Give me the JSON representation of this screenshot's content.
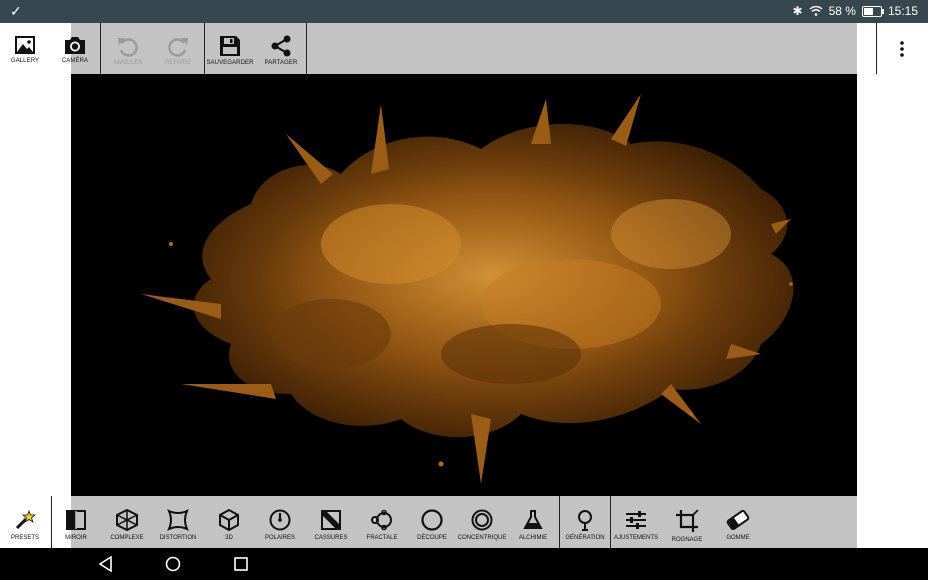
{
  "status_bar": {
    "notification_icon": "check-icon",
    "battery_percent": "58 %",
    "battery_level": 0.58,
    "time": "15:15"
  },
  "toolbar": {
    "gallery": "GALLERY",
    "camera": "CAMÉRA",
    "undo": "ANNULER",
    "redo": "REFAIRE",
    "save": "SAUVEGARDER",
    "share": "PARTAGER"
  },
  "effects_bar": {
    "presets": "PRESETS",
    "items": [
      {
        "label": "MIROIR",
        "icon": "mirror-icon"
      },
      {
        "label": "COMPLEXE",
        "icon": "complex-icon"
      },
      {
        "label": "DISTORTION",
        "icon": "distortion-icon"
      },
      {
        "label": "3D",
        "icon": "cube-icon"
      },
      {
        "label": "POLAIRES",
        "icon": "polar-icon"
      },
      {
        "label": "CASSURES",
        "icon": "breaks-icon"
      },
      {
        "label": "FRACTALE",
        "icon": "fractal-icon"
      },
      {
        "label": "DÉCOUPE",
        "icon": "cut-circle-icon"
      },
      {
        "label": "CONCENTRIQUE",
        "icon": "concentric-icon"
      },
      {
        "label": "ALCHIMIE",
        "icon": "flask-icon"
      },
      {
        "label": "GÉNÉRATION",
        "icon": "tree-icon"
      },
      {
        "label": "AJUSTEMENTS",
        "icon": "sliders-icon"
      },
      {
        "label": "ROGNAGE",
        "icon": "crop-icon"
      },
      {
        "label": "GOMME",
        "icon": "eraser-icon"
      }
    ]
  }
}
